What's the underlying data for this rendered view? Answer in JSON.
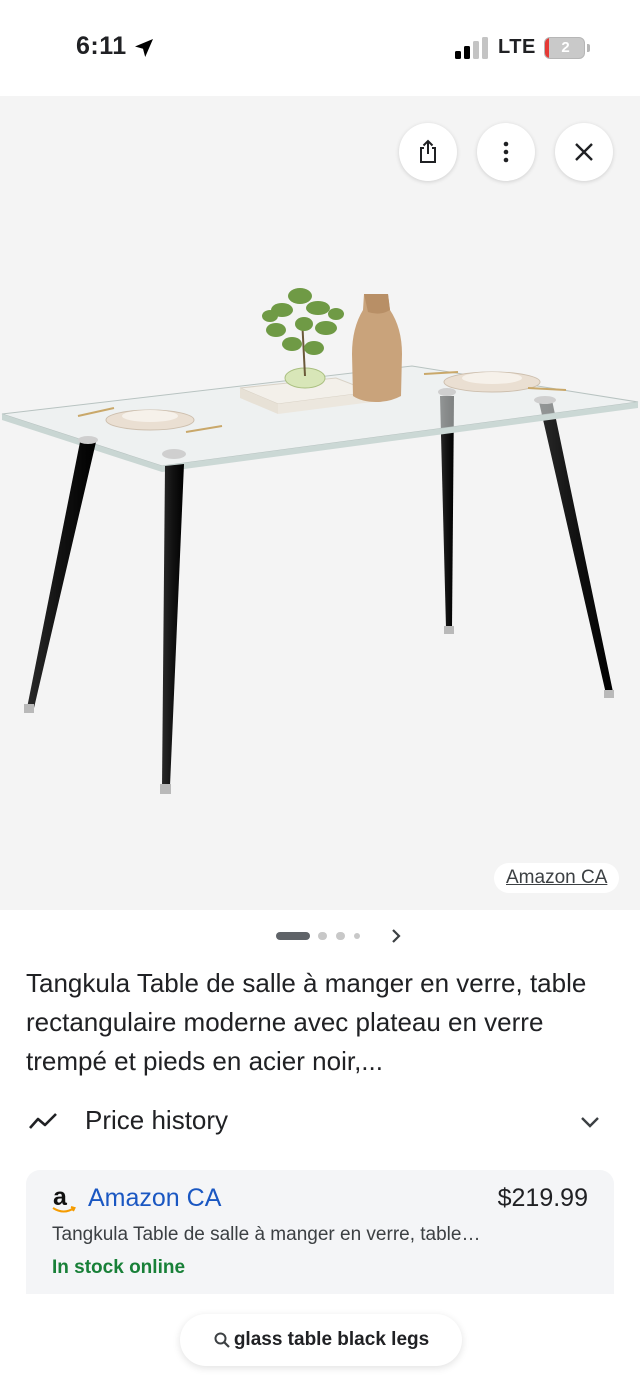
{
  "status_bar": {
    "time": "6:11",
    "network": "LTE",
    "battery": "2"
  },
  "image_viewer": {
    "source_label": "Amazon CA",
    "carousel_total": 4,
    "carousel_active": 1
  },
  "product": {
    "title": "Tangkula Table de salle à manger en verre, table rectangulaire moderne avec plateau en verre trempé et pieds en acier noir,..."
  },
  "price_history": {
    "label": "Price history"
  },
  "offer": {
    "seller_logo": "a",
    "seller_name": "Amazon CA",
    "price": "$219.99",
    "description": "Tangkula Table de salle à manger en verre, table…",
    "stock": "In stock online"
  },
  "search": {
    "query": "glass table black legs"
  },
  "colors": {
    "seller_link": "#1a57c2",
    "in_stock": "#188038",
    "battery_low": "#e53935"
  }
}
